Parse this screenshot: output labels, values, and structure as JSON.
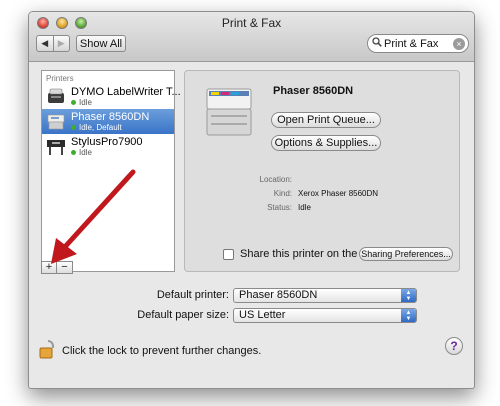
{
  "window": {
    "title": "Print & Fax"
  },
  "toolbar": {
    "back_icon": "left-arrow-icon",
    "forward_icon": "right-arrow-icon",
    "show_all_label": "Show All",
    "search_value": "Print & Fax",
    "search_icon": "search-icon"
  },
  "sidebar": {
    "heading": "Printers",
    "items": [
      {
        "name": "DYMO LabelWriter T...",
        "status": "Idle",
        "selected": false
      },
      {
        "name": "Phaser 8560DN",
        "status": "Idle, Default",
        "selected": true
      },
      {
        "name": "StylusPro7900",
        "status": "Idle",
        "selected": false
      }
    ],
    "add_label": "+",
    "remove_label": "−"
  },
  "detail": {
    "printer_name": "Phaser 8560DN",
    "open_queue_label": "Open Print Queue...",
    "options_label": "Options & Supplies...",
    "location_label": "Location:",
    "location_value": "",
    "kind_label": "Kind:",
    "kind_value": "Xerox Phaser 8560DN",
    "status_label": "Status:",
    "status_value": "Idle",
    "share_label": "Share this printer on the network",
    "share_checked": false,
    "sharing_prefs_label": "Sharing Preferences..."
  },
  "defaults": {
    "default_printer_label": "Default printer:",
    "default_printer_value": "Phaser 8560DN",
    "default_paper_label": "Default paper size:",
    "default_paper_value": "US Letter"
  },
  "footer": {
    "lock_text": "Click the lock to prevent further changes.",
    "help_label": "?"
  },
  "colors": {
    "selection": "#3a74c8",
    "arrow": "#c0181c",
    "status_dot": "#3fae2e"
  }
}
